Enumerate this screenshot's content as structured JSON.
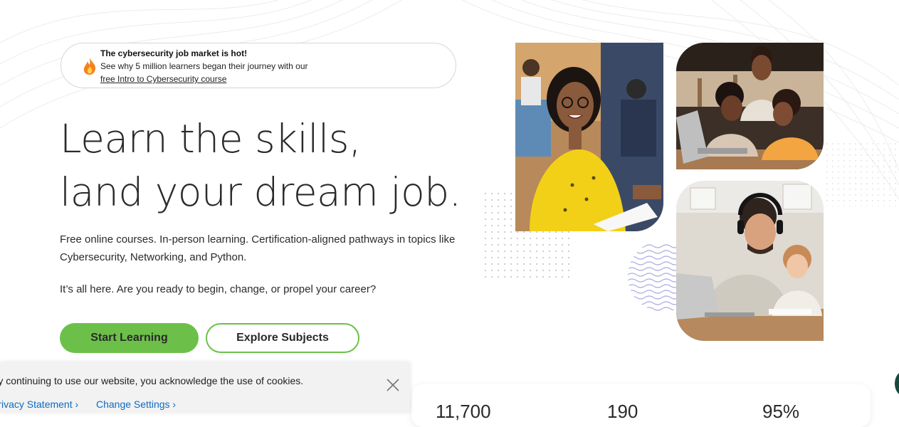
{
  "promo": {
    "title": "The cybersecurity job market is hot!",
    "text": "See why 5 million learners began their journey with our",
    "link": "free Intro to Cybersecurity course",
    "icon": "flame-icon"
  },
  "hero": {
    "line1": "Learn the skills,",
    "line2": "land your dream job.",
    "description": "Free online courses. In-person learning. Certification-aligned pathways in topics like Cybersecurity, Networking, and Python.",
    "question": "It’s all here. Are you ready to begin, change, or propel your career?"
  },
  "buttons": {
    "primary": "Start Learning",
    "secondary": "Explore Subjects"
  },
  "stats": [
    "11,700",
    "190",
    "95%"
  ],
  "cookie": {
    "text": "By continuing to use our website, you acknowledge the use of cookies.",
    "privacy": "Privacy Statement ›",
    "settings": "Change Settings ›",
    "close_icon": "close-icon"
  },
  "colors": {
    "accent": "#6cc04a",
    "link": "#0d6bc2",
    "text": "#2a2a2a"
  }
}
